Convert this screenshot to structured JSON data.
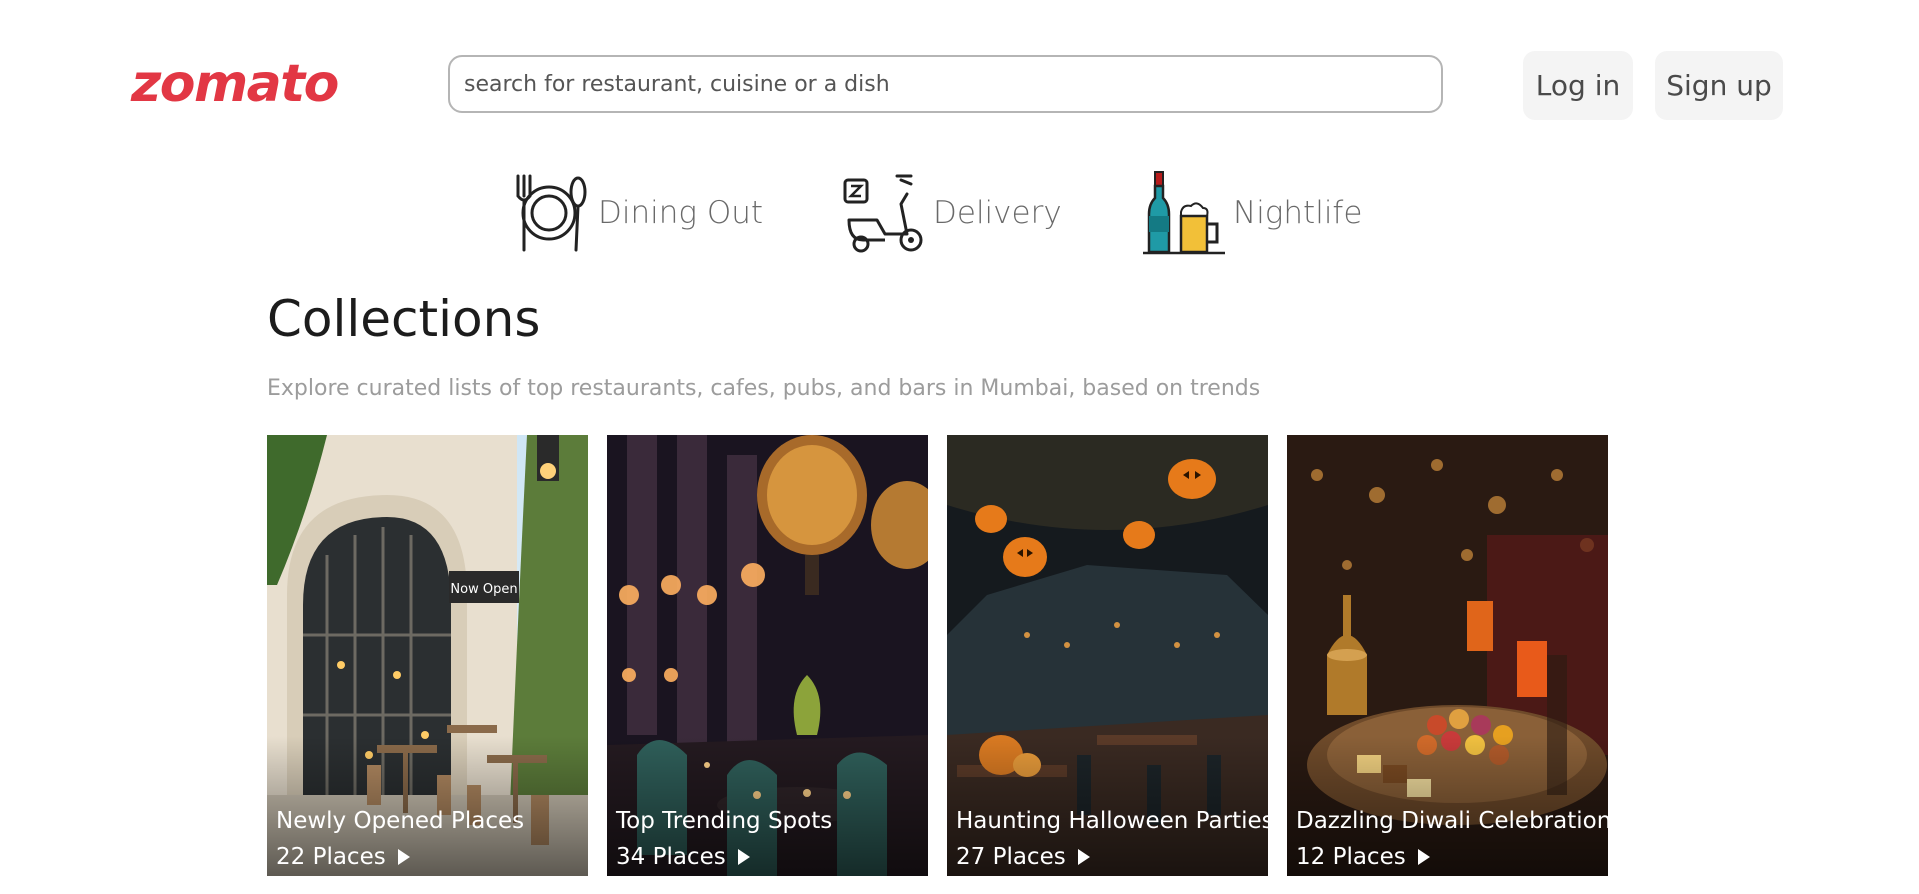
{
  "header": {
    "logo": "zomato",
    "search_placeholder": "search for restaurant, cuisine or a dish",
    "login_label": "Log in",
    "signup_label": "Sign up"
  },
  "tabs": [
    {
      "label": "Dining Out",
      "icon": "dining-out-icon"
    },
    {
      "label": "Delivery",
      "icon": "delivery-scooter-icon"
    },
    {
      "label": "Nightlife",
      "icon": "nightlife-drinks-icon"
    }
  ],
  "collections": {
    "title": "Collections",
    "subtitle": "Explore curated lists of top restaurants, cafes, pubs, and bars in Mumbai, based on trends",
    "cards": [
      {
        "title": "Newly Opened Places",
        "count": "22 Places"
      },
      {
        "title": "Top Trending Spots",
        "count": "34 Places"
      },
      {
        "title": "Haunting Halloween Parties",
        "count": "27 Places"
      },
      {
        "title": "Dazzling Diwali Celebrations",
        "count": "12 Places"
      }
    ],
    "sign_text": "Now Open"
  },
  "colors": {
    "brand": "#e23744",
    "tab_text": "#696969",
    "subtitle_text": "#9c9c9c"
  }
}
